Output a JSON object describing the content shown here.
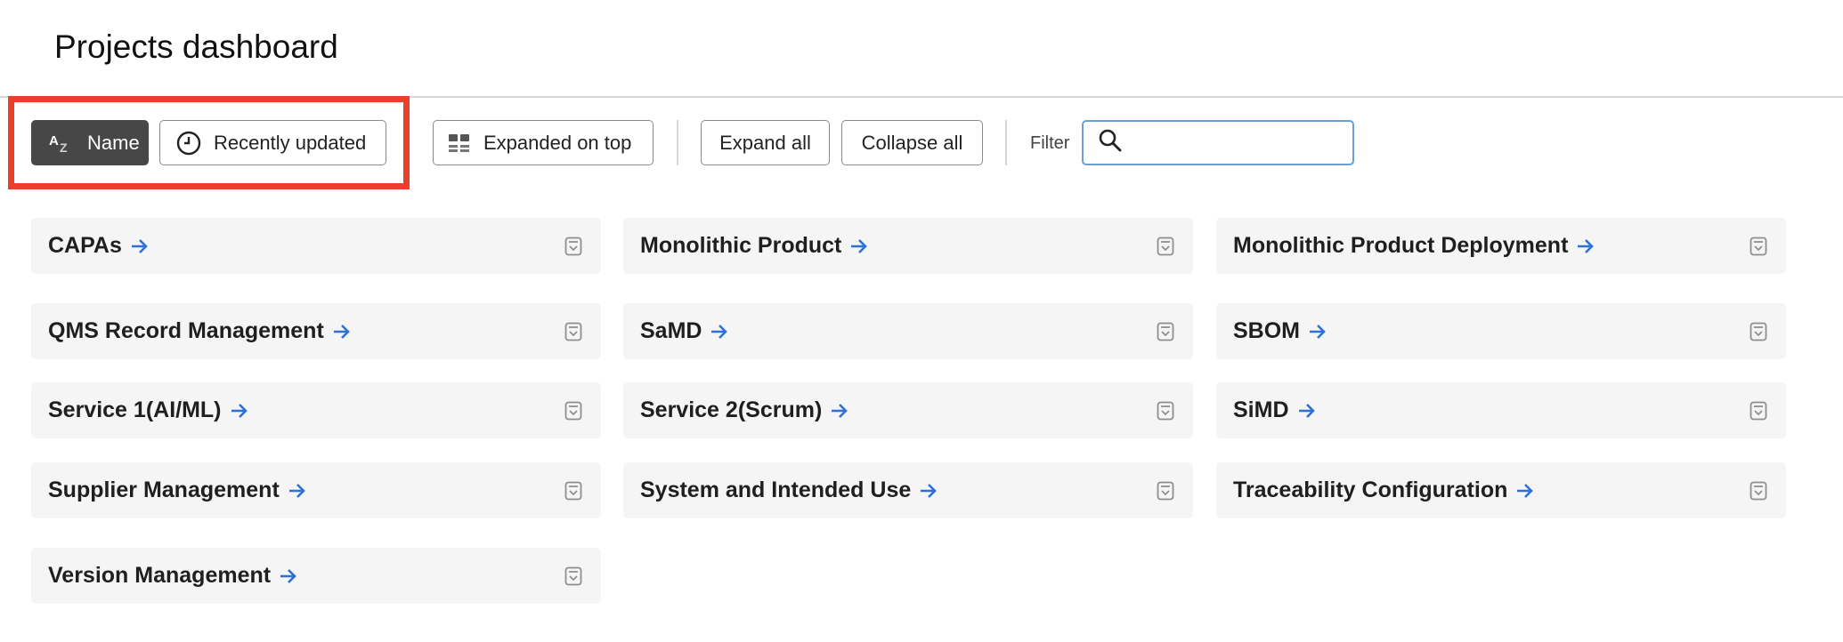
{
  "header": {
    "title": "Projects dashboard"
  },
  "toolbar": {
    "sort_name_label": "Name",
    "sort_recent_label": "Recently updated",
    "expanded_on_top_label": "Expanded on top",
    "expand_all_label": "Expand all",
    "collapse_all_label": "Collapse all",
    "filter_label": "Filter",
    "filter_value": "",
    "filter_placeholder": ""
  },
  "projects": [
    {
      "name": "CAPAs"
    },
    {
      "name": "Monolithic Product"
    },
    {
      "name": "Monolithic Product Deployment"
    },
    {
      "name": "QMS Record Management"
    },
    {
      "name": "SaMD"
    },
    {
      "name": "SBOM"
    },
    {
      "name": "Service 1(AI/ML)"
    },
    {
      "name": "Service 2(Scrum)"
    },
    {
      "name": "SiMD"
    },
    {
      "name": "Supplier Management"
    },
    {
      "name": "System and Intended Use"
    },
    {
      "name": "Traceability Configuration"
    },
    {
      "name": "Version Management"
    }
  ],
  "colors": {
    "accent": "#2f6fd6",
    "highlight": "#e8402a",
    "active_button": "#474747",
    "card_bg": "#f5f5f5"
  },
  "icons": {
    "sort_name": "az-sort-icon",
    "sort_recent": "clock-icon",
    "layout": "grid-layout-icon",
    "search": "search-icon",
    "arrow": "arrow-right-icon",
    "toggle": "collapse-toggle-icon"
  }
}
